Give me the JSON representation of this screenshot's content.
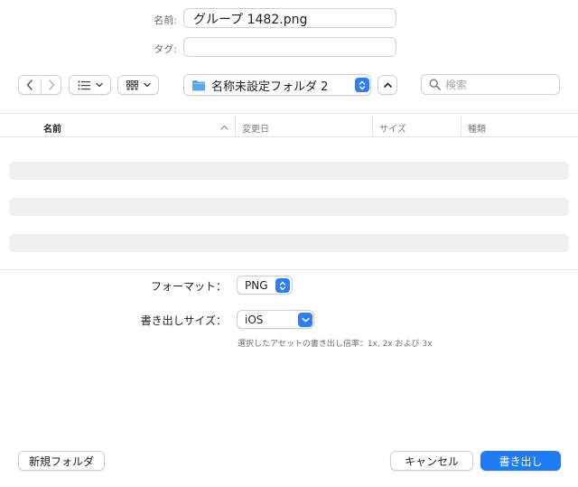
{
  "form": {
    "name_label": "名前:",
    "name_value": "グループ 1482.png",
    "tag_label": "タグ:",
    "tag_value": ""
  },
  "toolbar": {
    "back_icon": "chevron-left-icon",
    "forward_icon": "chevron-right-icon",
    "list_view_icon": "list-icon",
    "grid_view_icon": "grid-icon",
    "folder_name": "名称未設定フォルダ 2",
    "search_placeholder": "検索"
  },
  "browser": {
    "columns": [
      "名前",
      "変更日",
      "サイズ",
      "種類"
    ],
    "sort_column": "名前",
    "sort_direction": "ascending"
  },
  "options": {
    "format_label": "フォーマット：",
    "format_value": "PNG",
    "export_size_label": "書き出しサイズ：",
    "export_size_value": "iOS",
    "export_size_hint": "選択したアセットの書き出し倍率：1x, 2x および 3x"
  },
  "footer": {
    "new_folder_label": "新規フォルダ",
    "cancel_label": "キャンセル",
    "export_label": "書き出し"
  },
  "colors": {
    "accent": "#1f7cf4",
    "folder_icon": "#5aa7e8"
  }
}
